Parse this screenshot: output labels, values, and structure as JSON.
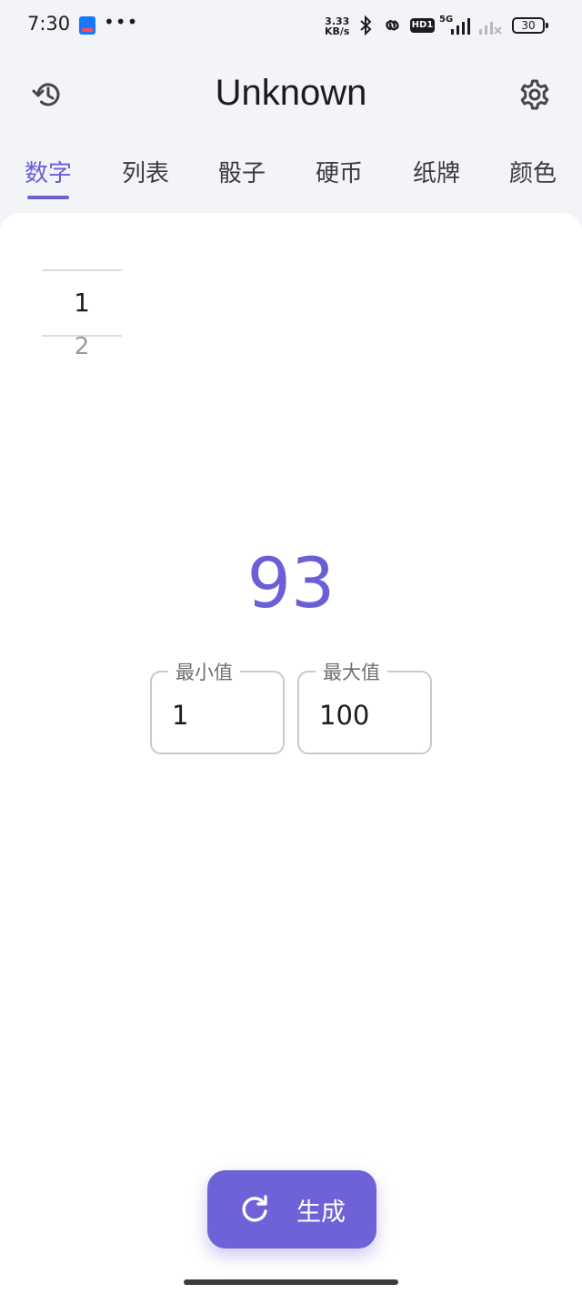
{
  "status_bar": {
    "time": "7:30",
    "more_indicator": "•••",
    "net_speed_value": "3.33",
    "net_speed_unit": "KB/s",
    "hd_badge": "HD1",
    "network_type": "5G",
    "battery_level": "30"
  },
  "app_bar": {
    "title": "Unknown",
    "history_icon": "history-icon",
    "settings_icon": "gear-icon"
  },
  "tabs": [
    {
      "label": "数字",
      "active": true
    },
    {
      "label": "列表",
      "active": false
    },
    {
      "label": "骰子",
      "active": false
    },
    {
      "label": "硬币",
      "active": false
    },
    {
      "label": "纸牌",
      "active": false
    },
    {
      "label": "颜色",
      "active": false
    }
  ],
  "picker": {
    "selected": "1",
    "next": "2"
  },
  "result": "93",
  "range": {
    "min_label": "最小值",
    "min_value": "1",
    "max_label": "最大值",
    "max_value": "100"
  },
  "generate_button": {
    "label": "生成",
    "icon": "refresh-icon"
  },
  "colors": {
    "accent": "#6b5fd6",
    "button": "#6e62d8",
    "background": "#f3f4f8",
    "card": "#ffffff"
  }
}
